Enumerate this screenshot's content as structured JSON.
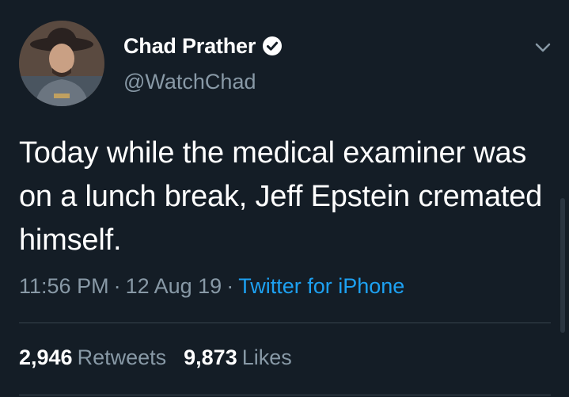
{
  "author": {
    "display_name": "Chad Prather",
    "handle": "@WatchChad",
    "verified": true
  },
  "tweet": {
    "text": "Today while the medical examiner was on a lunch break, Jeff Epstein cremated himself.",
    "time": "11:56 PM",
    "date": "12 Aug 19",
    "separator": "·",
    "source": "Twitter for iPhone"
  },
  "stats": {
    "retweets_count": "2,946",
    "retweets_label": "Retweets",
    "likes_count": "9,873",
    "likes_label": "Likes"
  },
  "icons": {
    "verified": "verified-badge-icon",
    "menu": "chevron-down-icon"
  },
  "colors": {
    "background": "#141d26",
    "text_primary": "#ffffff",
    "text_secondary": "#8899a6",
    "accent": "#1da1f2",
    "divider": "#38444d"
  }
}
